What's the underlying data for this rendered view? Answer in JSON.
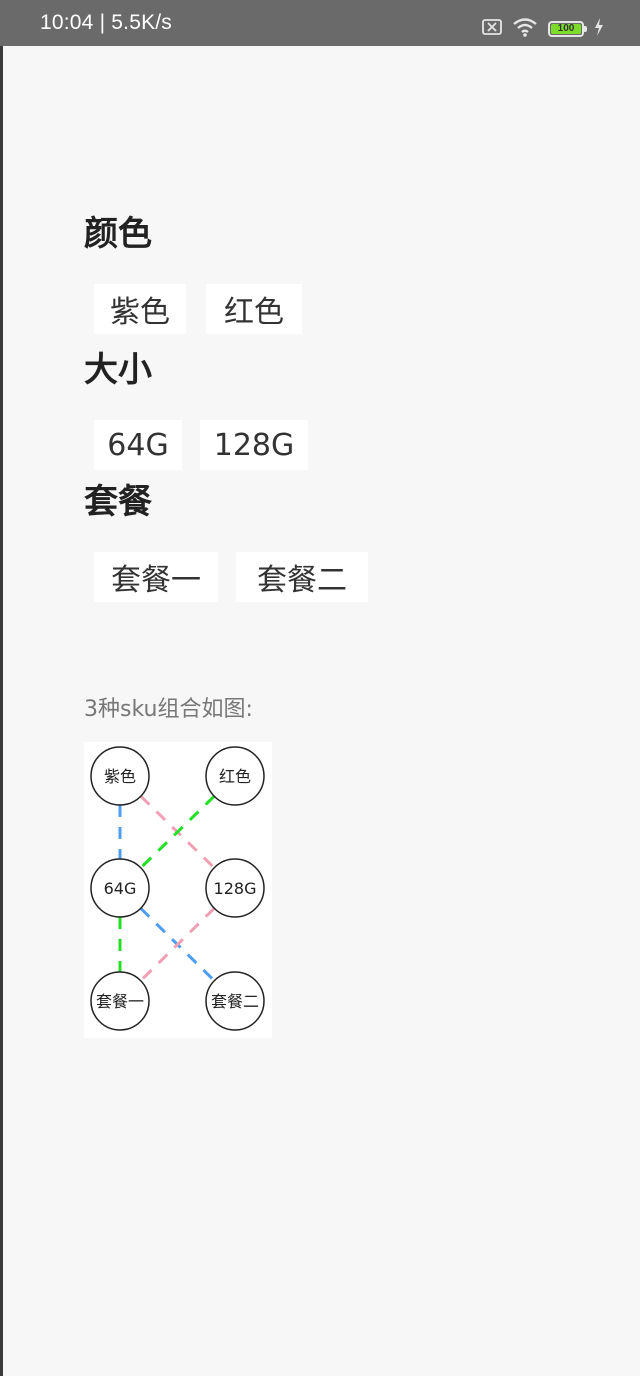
{
  "status_bar": {
    "time_speed": "10:04 | 5.5K/s",
    "battery_level": "100"
  },
  "groups": [
    {
      "title": "颜色",
      "options": [
        "紫色",
        "红色"
      ]
    },
    {
      "title": "大小",
      "options": [
        "64G",
        "128G"
      ]
    },
    {
      "title": "套餐",
      "options": [
        "套餐一",
        "套餐二"
      ]
    }
  ],
  "caption": "3种sku组合如图:",
  "diagram": {
    "nodes": [
      {
        "label": "紫色",
        "col": 0,
        "row": 0
      },
      {
        "label": "红色",
        "col": 1,
        "row": 0
      },
      {
        "label": "64G",
        "col": 0,
        "row": 1
      },
      {
        "label": "128G",
        "col": 1,
        "row": 1
      },
      {
        "label": "套餐一",
        "col": 0,
        "row": 2
      },
      {
        "label": "套餐二",
        "col": 1,
        "row": 2
      }
    ],
    "paths": [
      {
        "color": "#4f9df0",
        "links": [
          [
            "紫色",
            "64G"
          ],
          [
            "64G",
            "套餐二"
          ]
        ]
      },
      {
        "color": "#f0a0b4",
        "links": [
          [
            "紫色",
            "128G"
          ],
          [
            "128G",
            "套餐一"
          ]
        ]
      },
      {
        "color": "#22e022",
        "links": [
          [
            "红色",
            "64G"
          ],
          [
            "64G",
            "套餐一"
          ]
        ]
      }
    ]
  }
}
